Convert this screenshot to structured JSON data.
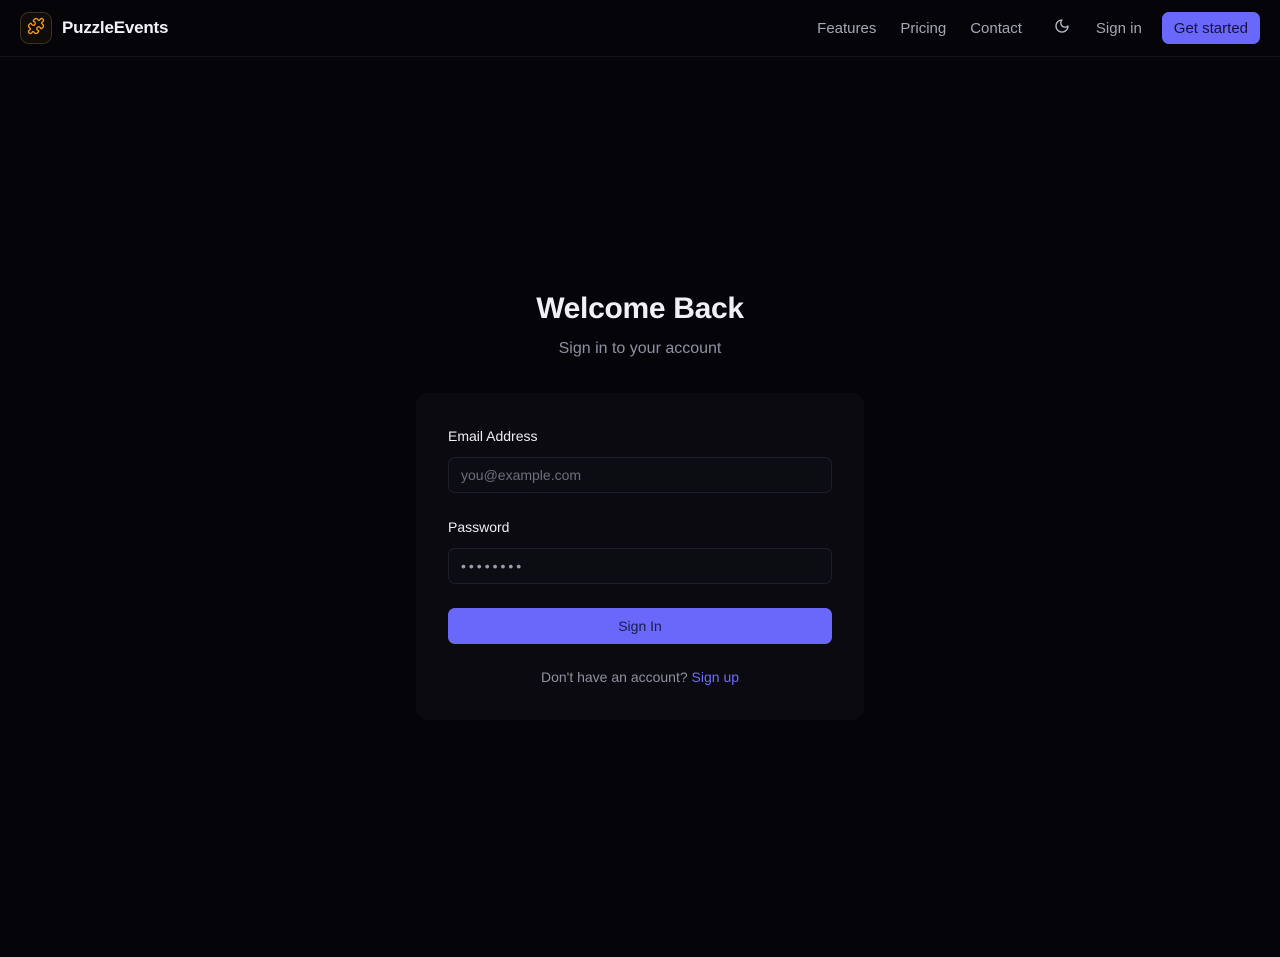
{
  "header": {
    "brand_name": "PuzzleEvents",
    "brand_icon": "puzzle-icon",
    "nav": [
      {
        "label": "Features"
      },
      {
        "label": "Pricing"
      },
      {
        "label": "Contact"
      }
    ],
    "theme_icon": "moon-icon",
    "signin_label": "Sign in",
    "cta_label": "Get started"
  },
  "main": {
    "title": "Welcome Back",
    "subtitle": "Sign in to your account"
  },
  "form": {
    "email_label": "Email Address",
    "email_placeholder": "you@example.com",
    "email_value": "",
    "password_label": "Password",
    "password_value": "••••••••",
    "submit_label": "Sign In",
    "footer_prompt": "Don't have an account?",
    "footer_link": "Sign up"
  },
  "colors": {
    "background": "#040409",
    "card": "#0a0a10",
    "accent": "#6a68fb",
    "link": "#6f6dff",
    "logo_orange": "#f29a1c"
  }
}
